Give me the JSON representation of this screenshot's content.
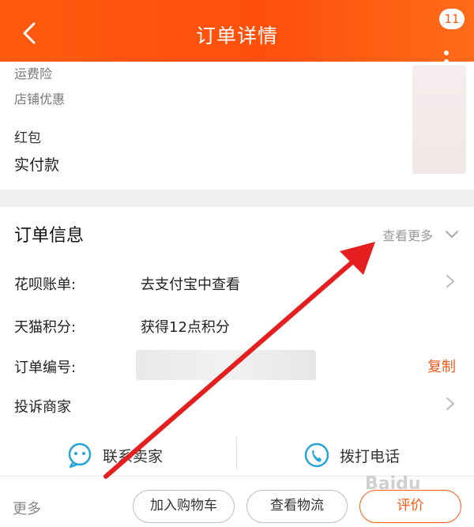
{
  "header": {
    "title": "订单详情",
    "badge_count": "11",
    "brand_color": "#ff5a10"
  },
  "price_rows": [
    {
      "label": "运费险"
    },
    {
      "label": "店铺优惠"
    },
    {
      "label": "红包"
    },
    {
      "label": "实付款"
    }
  ],
  "order_info": {
    "title": "订单信息",
    "see_more": "查看更多",
    "rows": [
      {
        "label": "花呗账单:",
        "value": "去支付宝中查看"
      },
      {
        "label": "天猫积分:",
        "value": "获得12点积分"
      },
      {
        "label": "订单编号:",
        "value": ""
      },
      {
        "label": "投诉商家",
        "value": ""
      }
    ],
    "copy_label": "复制",
    "accent_color": "#ee5a1c"
  },
  "contact": {
    "seller_label": "联系卖家",
    "phone_label": "拨打电话"
  },
  "bottom": {
    "more_label": "更多",
    "add_cart_label": "加入购物车",
    "logistics_label": "查看物流",
    "review_label": "评价"
  },
  "watermark": "Baidu"
}
